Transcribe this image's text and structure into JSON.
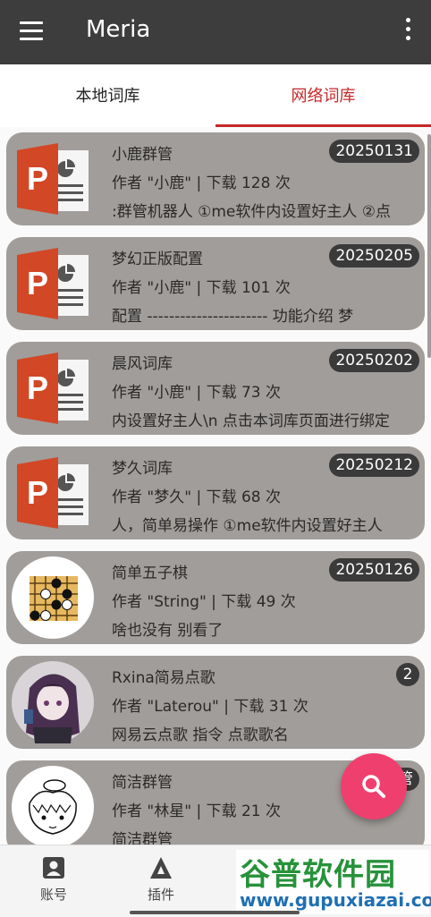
{
  "appbar": {
    "title": "Meria"
  },
  "tabs": [
    {
      "label": "本地词库",
      "active": false
    },
    {
      "label": "网络词库",
      "active": true
    }
  ],
  "colors": {
    "appbar": "#3d3d3d",
    "accent": "#c62828",
    "card": "#a19d9a",
    "fab": "#ef3f6e"
  },
  "items": [
    {
      "name": "小鹿群管",
      "meta": "作者 \"小鹿\" | 下载 128 次",
      "desc": ":群管机器人 ①me软件内设置好主人 ②点",
      "badge": "20250131",
      "icon": "powerpoint-icon"
    },
    {
      "name": "梦幻正版配置",
      "meta": "作者 \"小鹿\" | 下载 101 次",
      "desc": "配置 ---------------------- 功能介绍 梦",
      "badge": "20250205",
      "icon": "powerpoint-icon"
    },
    {
      "name": "晨风词库",
      "meta": "作者 \"小鹿\" | 下载 73 次",
      "desc": "内设置好主人\\n 点击本词库页面进行绑定",
      "badge": "20250202",
      "icon": "powerpoint-icon"
    },
    {
      "name": "梦久词库",
      "meta": "作者 \"梦久\" | 下载 68 次",
      "desc": "人，简单易操作 ①me软件内设置好主人",
      "badge": "20250212",
      "icon": "powerpoint-icon"
    },
    {
      "name": "简单五子棋",
      "meta": "作者 \"String\" | 下载 49 次",
      "desc": "啥也没有 别看了",
      "badge": "20250126",
      "icon": "gomoku-board-icon"
    },
    {
      "name": "Rxina简易点歌",
      "meta": "作者 \"Laterou\" | 下载 31 次",
      "desc": "网易云点歌  指令 点歌歌名",
      "badge": "2",
      "icon": "anime-avatar-icon"
    },
    {
      "name": "简洁群管",
      "meta": "作者 \"林星\" | 下载 21 次",
      "desc": "简洁群管",
      "badge": "管",
      "icon": "cartoon-face-icon"
    }
  ],
  "bottom_nav": [
    {
      "label": "账号",
      "icon": "account-icon"
    },
    {
      "label": "插件",
      "icon": "plugin-icon"
    }
  ],
  "watermark": {
    "title": "谷普软件园",
    "url": "www.gupuxiazai.com"
  }
}
